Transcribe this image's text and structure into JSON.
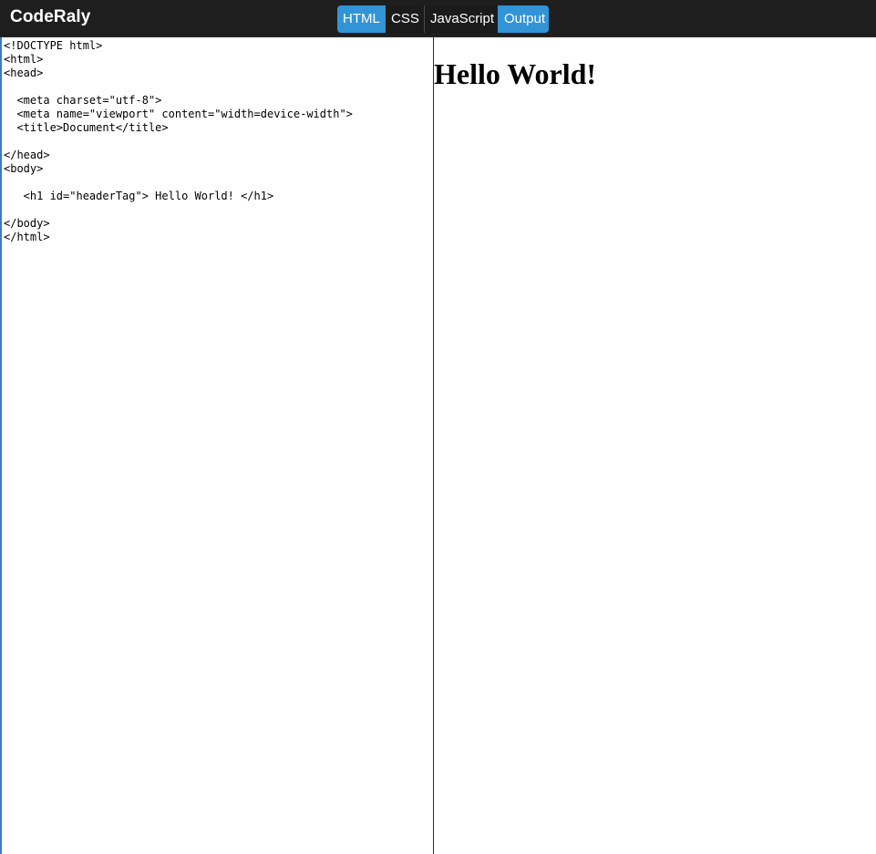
{
  "app": {
    "title": "CodeRaly"
  },
  "tabs": [
    {
      "label": "HTML",
      "active": true
    },
    {
      "label": "CSS",
      "active": false
    },
    {
      "label": "JavaScript",
      "active": false
    },
    {
      "label": "Output",
      "active": true
    }
  ],
  "editor": {
    "code": "<!DOCTYPE html>\n<html>\n<head>\n\n  <meta charset=\"utf-8\">\n  <meta name=\"viewport\" content=\"width=device-width\">\n  <title>Document</title>\n\n</head>\n<body>\n\n   <h1 id=\"headerTag\"> Hello World! </h1>\n\n</body>\n</html>"
  },
  "output": {
    "heading": "Hello World!"
  },
  "colors": {
    "topbar_bg": "#1e1e1e",
    "accent": "#3294d6",
    "text_light": "#ffffff"
  }
}
